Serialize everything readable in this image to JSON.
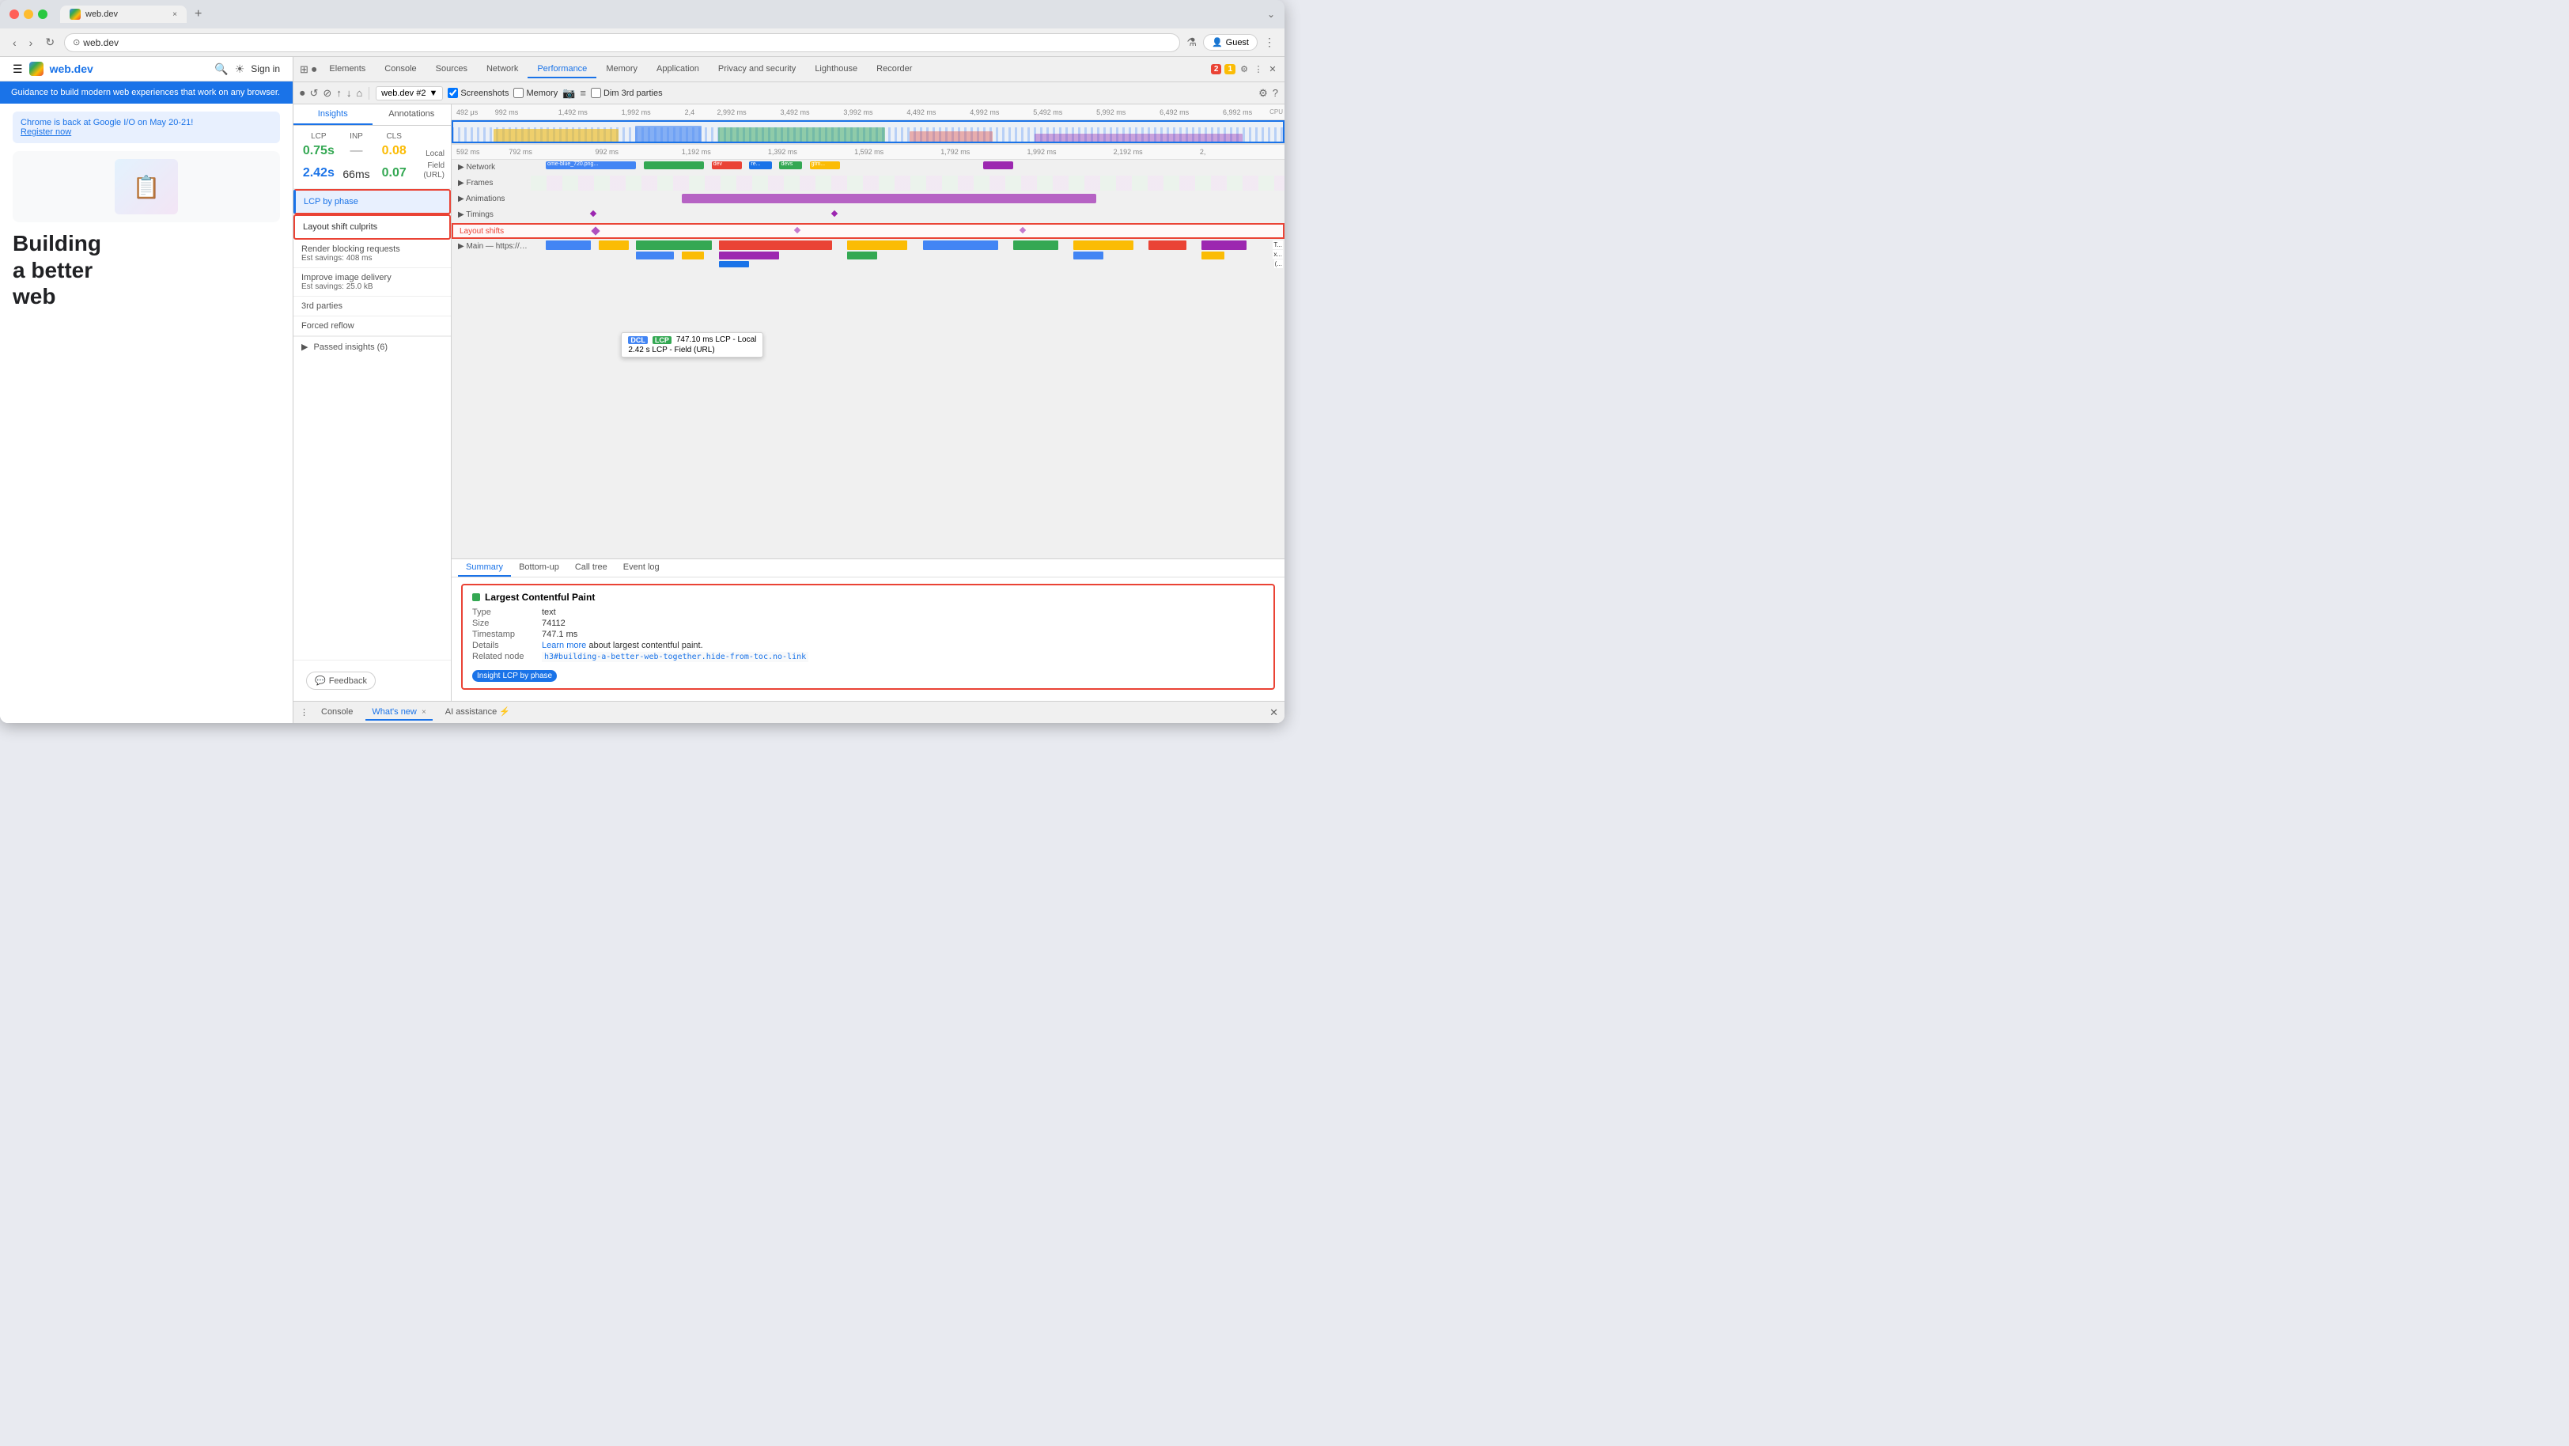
{
  "browser": {
    "tab_title": "web.dev",
    "tab_close": "×",
    "new_tab": "+",
    "address": "web.dev",
    "back": "‹",
    "forward": "›",
    "refresh": "↻",
    "guest_label": "Guest",
    "dropdown_icon": "⌄"
  },
  "webpage": {
    "nav_title": "web.dev",
    "header_text": "Guidance to build modern web experiences that work on any browser.",
    "announcement": "Chrome is back at Google I/O on May 20-21!",
    "register_link": "Register now",
    "hero_line1": "Building",
    "hero_line2": "a better",
    "hero_line3": "web"
  },
  "devtools": {
    "tabs": [
      "Elements",
      "Console",
      "Sources",
      "Network",
      "Performance",
      "Memory",
      "Application",
      "Privacy and security",
      "Lighthouse",
      "Recorder"
    ],
    "active_tab": "Performance",
    "profile_selector": "web.dev #2",
    "screenshots_label": "Screenshots",
    "memory_label": "Memory",
    "dim_3rd_label": "Dim 3rd parties",
    "error_count": "2",
    "warn_count": "1"
  },
  "ruler": {
    "marks": [
      "492 μs",
      "992 ms",
      "1,492 ms",
      "1,992 ms",
      "2,4",
      "ms",
      "2,992 ms",
      "3,492 ms",
      "3,992 ms",
      "4,492 ms",
      "4,992 ms",
      "5,492 ms",
      "5,992 ms",
      "6,492 ms",
      "6,992 ms"
    ]
  },
  "timeline_rows": [
    {
      "label": "Network",
      "type": "network"
    },
    {
      "label": "Frames",
      "type": "frames"
    },
    {
      "label": "Animations",
      "type": "animations"
    },
    {
      "label": "Timings",
      "type": "timings"
    },
    {
      "label": "Layout shifts",
      "type": "layout_shifts",
      "highlight": true
    },
    {
      "label": "Main — https://web.dev/",
      "type": "main"
    }
  ],
  "insights": {
    "tabs": [
      "Insights",
      "Annotations"
    ],
    "active_tab": "Insights",
    "metrics": {
      "lcp_label": "LCP",
      "inp_label": "INP",
      "cls_label": "CLS",
      "lcp_local": "0.75s",
      "inp_local": "—",
      "cls_local": "0.08",
      "source_local": "Local",
      "lcp_field": "2.42s",
      "inp_field": "66ms",
      "cls_field": "0.07",
      "source_field": "Field (URL)"
    },
    "items": [
      {
        "label": "LCP by phase",
        "active": true,
        "red_border": true
      },
      {
        "label": "Layout shift culprits",
        "active": false,
        "red_border": true
      },
      {
        "label": "Render blocking requests",
        "sub": "Est savings: 408 ms"
      },
      {
        "label": "Improve image delivery",
        "sub": "Est savings: 25.0 kB"
      },
      {
        "label": "3rd parties"
      },
      {
        "label": "Forced reflow"
      }
    ],
    "passed_insights": "Passed insights (6)",
    "feedback_label": "Feedback"
  },
  "summary": {
    "tabs": [
      "Summary",
      "Bottom-up",
      "Call tree",
      "Event log"
    ],
    "active_tab": "Summary",
    "lcp": {
      "title": "Largest Contentful Paint",
      "type_label": "Type",
      "type_val": "text",
      "size_label": "Size",
      "size_val": "74112",
      "timestamp_label": "Timestamp",
      "timestamp_val": "747.1 ms",
      "details_label": "Details",
      "details_link": "Learn more",
      "details_text": "about largest contentful paint.",
      "node_label": "Related node",
      "node_val": "h3#building-a-better-web-together.hide-from-toc.no-link",
      "insight_label": "Insight",
      "insight_btn": "LCP by phase"
    }
  },
  "bottom_bar": {
    "tabs": [
      "Console",
      "What's new",
      "AI assistance"
    ],
    "active_tab": "What's new",
    "close_icon": "×",
    "ai_icon": "⚡"
  },
  "tooltip": {
    "line1": "747.10 ms LCP - Local",
    "line2": "2.42 s LCP - Field (URL)",
    "dcl_label": "DCL",
    "lcp_label": "LCP"
  }
}
